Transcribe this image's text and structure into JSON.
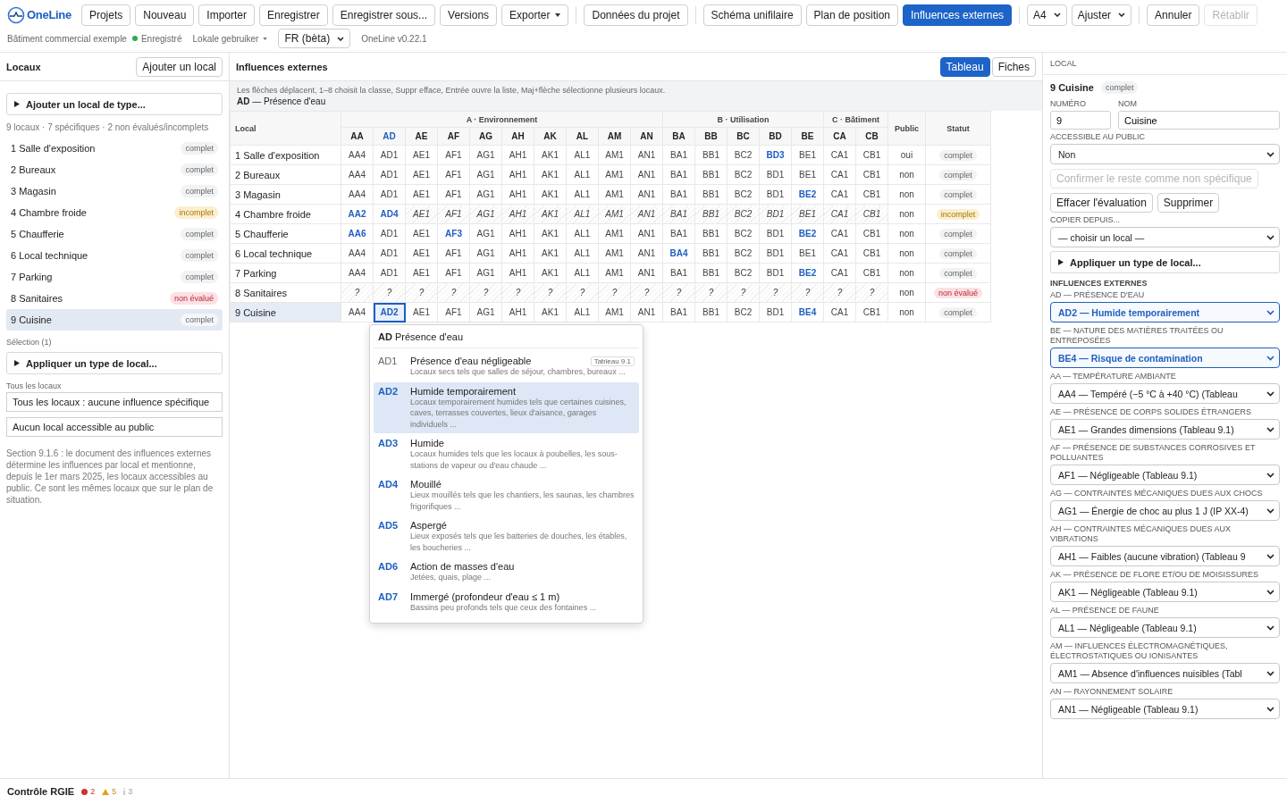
{
  "app": {
    "logo": "OneLine"
  },
  "toolbar": {
    "groups": [
      {
        "items": [
          {
            "label": "Projets",
            "kind": "button"
          },
          {
            "label": "Nouveau",
            "kind": "button"
          },
          {
            "label": "Importer",
            "kind": "button"
          },
          {
            "label": "Enregistrer",
            "kind": "button"
          },
          {
            "label": "Enregistrer sous...",
            "kind": "button"
          },
          {
            "label": "Versions",
            "kind": "button"
          },
          {
            "label": "Exporter",
            "kind": "menu"
          }
        ]
      },
      {
        "items": [
          {
            "label": "Données du projet",
            "kind": "button"
          }
        ]
      },
      {
        "items": [
          {
            "label": "Schéma unifilaire",
            "kind": "tab",
            "selected": false
          },
          {
            "label": "Plan de position",
            "kind": "tab",
            "selected": false
          },
          {
            "label": "Influences externes",
            "kind": "tab",
            "selected": true
          }
        ]
      },
      {
        "items": [
          {
            "label": "A4",
            "kind": "select"
          },
          {
            "label": "Ajuster",
            "kind": "select"
          }
        ]
      },
      {
        "items": [
          {
            "label": "Annuler",
            "kind": "button",
            "disabled": false
          },
          {
            "label": "Rétablir",
            "kind": "button",
            "disabled": true
          }
        ]
      }
    ]
  },
  "info_bar": {
    "project": "Bâtiment commercial exemple",
    "save_state": "Enregistré",
    "user": "Lokale gebruiker",
    "language": "FR (bèta)",
    "version": "OneLine v0.22.1"
  },
  "sidebar": {
    "title": "Locaux",
    "add_button": "Ajouter un local",
    "add_type": "Ajouter un local de type...",
    "summary": "9 locaux · 7 spécifiques · 2 non évalués/incomplets",
    "items": [
      {
        "label": "1 Salle d'exposition",
        "status": "complet",
        "kind": "complete",
        "selected": false
      },
      {
        "label": "2 Bureaux",
        "status": "complet",
        "kind": "complete",
        "selected": false
      },
      {
        "label": "3 Magasin",
        "status": "complet",
        "kind": "complete",
        "selected": false
      },
      {
        "label": "4 Chambre froide",
        "status": "incomplet",
        "kind": "incomplete",
        "selected": false
      },
      {
        "label": "5 Chaufferie",
        "status": "complet",
        "kind": "complete",
        "selected": false
      },
      {
        "label": "6 Local technique",
        "status": "complet",
        "kind": "complete",
        "selected": false
      },
      {
        "label": "7 Parking",
        "status": "complet",
        "kind": "complete",
        "selected": false
      },
      {
        "label": "8 Sanitaires",
        "status": "non évalué",
        "kind": "unevaluated",
        "selected": false
      },
      {
        "label": "9 Cuisine",
        "status": "complet",
        "kind": "complete",
        "selected": true
      }
    ],
    "selection_label": "Sélection (1)",
    "apply_type": "Appliquer un type de local...",
    "all_label": "Tous les locaux",
    "all_buttons": [
      "Tous les locaux : aucune influence spécifique",
      "Aucun local accessible au public"
    ],
    "note": "Section 9.1.6 : le document des influences externes détermine les influences par local et mentionne, depuis le 1er mars 2025, les locaux accessibles au public. Ce sont les mêmes locaux que sur le plan de situation."
  },
  "center": {
    "title": "Influences externes",
    "views": [
      {
        "label": "Tableau",
        "selected": true
      },
      {
        "label": "Fiches",
        "selected": false
      }
    ],
    "hint": "Les flèches déplacent, 1–8 choisit la classe, Suppr efface, Entrée ouvre la liste, Maj+flèche sélectionne plusieurs locaux.",
    "current_influence": "**AD** — Présence d'eau",
    "table": {
      "local_header": "Local",
      "public_header": "Public",
      "status_header": "Statut",
      "groups": [
        {
          "label": "A · Environnement",
          "columns": [
            {
              "label": "AA",
              "selected": false
            },
            {
              "label": "AD",
              "selected": true
            },
            {
              "label": "AE",
              "selected": false
            },
            {
              "label": "AF",
              "selected": false
            },
            {
              "label": "AG",
              "selected": false
            },
            {
              "label": "AH",
              "selected": false
            },
            {
              "label": "AK",
              "selected": false
            },
            {
              "label": "AL",
              "selected": false
            },
            {
              "label": "AM",
              "selected": false
            },
            {
              "label": "AN",
              "selected": false
            }
          ]
        },
        {
          "label": "B · Utilisation",
          "columns": [
            {
              "label": "BA",
              "selected": false
            },
            {
              "label": "BB",
              "selected": false
            },
            {
              "label": "BC",
              "selected": false
            },
            {
              "label": "BD",
              "selected": false
            },
            {
              "label": "BE",
              "selected": false
            }
          ]
        },
        {
          "label": "C · Bâtiment",
          "columns": [
            {
              "label": "CA",
              "selected": false
            },
            {
              "label": "CB",
              "selected": false
            }
          ]
        }
      ],
      "rows": [
        {
          "local": "1 Salle d'exposition",
          "selected": false,
          "public": "oui",
          "status": "complet",
          "kind": "complete",
          "cells": [
            {
              "value": "AA4",
              "kind": "default"
            },
            {
              "value": "AD1",
              "kind": "default"
            },
            {
              "value": "AE1",
              "kind": "default"
            },
            {
              "value": "AF1",
              "kind": "default"
            },
            {
              "value": "AG1",
              "kind": "default"
            },
            {
              "value": "AH1",
              "kind": "default"
            },
            {
              "value": "AK1",
              "kind": "default"
            },
            {
              "value": "AL1",
              "kind": "default"
            },
            {
              "value": "AM1",
              "kind": "default"
            },
            {
              "value": "AN1",
              "kind": "default"
            },
            {
              "value": "BA1",
              "kind": "default"
            },
            {
              "value": "BB1",
              "kind": "default"
            },
            {
              "value": "BC2",
              "kind": "default"
            },
            {
              "value": "BD3",
              "kind": "specific"
            },
            {
              "value": "BE1",
              "kind": "default"
            },
            {
              "value": "CA1",
              "kind": "default"
            },
            {
              "value": "CB1",
              "kind": "default"
            }
          ]
        },
        {
          "local": "2 Bureaux",
          "selected": false,
          "public": "non",
          "status": "complet",
          "kind": "complete",
          "cells": [
            {
              "value": "AA4",
              "kind": "default"
            },
            {
              "value": "AD1",
              "kind": "default"
            },
            {
              "value": "AE1",
              "kind": "default"
            },
            {
              "value": "AF1",
              "kind": "default"
            },
            {
              "value": "AG1",
              "kind": "default"
            },
            {
              "value": "AH1",
              "kind": "default"
            },
            {
              "value": "AK1",
              "kind": "default"
            },
            {
              "value": "AL1",
              "kind": "default"
            },
            {
              "value": "AM1",
              "kind": "default"
            },
            {
              "value": "AN1",
              "kind": "default"
            },
            {
              "value": "BA1",
              "kind": "default"
            },
            {
              "value": "BB1",
              "kind": "default"
            },
            {
              "value": "BC2",
              "kind": "default"
            },
            {
              "value": "BD1",
              "kind": "default"
            },
            {
              "value": "BE1",
              "kind": "default"
            },
            {
              "value": "CA1",
              "kind": "default"
            },
            {
              "value": "CB1",
              "kind": "default"
            }
          ]
        },
        {
          "local": "3 Magasin",
          "selected": false,
          "public": "non",
          "status": "complet",
          "kind": "complete",
          "cells": [
            {
              "value": "AA4",
              "kind": "default"
            },
            {
              "value": "AD1",
              "kind": "default"
            },
            {
              "value": "AE1",
              "kind": "default"
            },
            {
              "value": "AF1",
              "kind": "default"
            },
            {
              "value": "AG1",
              "kind": "default"
            },
            {
              "value": "AH1",
              "kind": "default"
            },
            {
              "value": "AK1",
              "kind": "default"
            },
            {
              "value": "AL1",
              "kind": "default"
            },
            {
              "value": "AM1",
              "kind": "default"
            },
            {
              "value": "AN1",
              "kind": "default"
            },
            {
              "value": "BA1",
              "kind": "default"
            },
            {
              "value": "BB1",
              "kind": "default"
            },
            {
              "value": "BC2",
              "kind": "default"
            },
            {
              "value": "BD1",
              "kind": "default"
            },
            {
              "value": "BE2",
              "kind": "specific"
            },
            {
              "value": "CA1",
              "kind": "default"
            },
            {
              "value": "CB1",
              "kind": "default"
            }
          ]
        },
        {
          "local": "4 Chambre froide",
          "selected": false,
          "public": "non",
          "status": "incomplet",
          "kind": "incomplete",
          "cells": [
            {
              "value": "AA2",
              "kind": "specific"
            },
            {
              "value": "AD4",
              "kind": "specific"
            },
            {
              "value": "AE1",
              "kind": "pending"
            },
            {
              "value": "AF1",
              "kind": "pending"
            },
            {
              "value": "AG1",
              "kind": "pending"
            },
            {
              "value": "AH1",
              "kind": "pending"
            },
            {
              "value": "AK1",
              "kind": "pending"
            },
            {
              "value": "AL1",
              "kind": "pending"
            },
            {
              "value": "AM1",
              "kind": "pending"
            },
            {
              "value": "AN1",
              "kind": "pending"
            },
            {
              "value": "BA1",
              "kind": "pending"
            },
            {
              "value": "BB1",
              "kind": "pending"
            },
            {
              "value": "BC2",
              "kind": "pending"
            },
            {
              "value": "BD1",
              "kind": "pending"
            },
            {
              "value": "BE1",
              "kind": "pending"
            },
            {
              "value": "CA1",
              "kind": "pending"
            },
            {
              "value": "CB1",
              "kind": "pending"
            }
          ]
        },
        {
          "local": "5 Chaufferie",
          "selected": false,
          "public": "non",
          "status": "complet",
          "kind": "complete",
          "cells": [
            {
              "value": "AA6",
              "kind": "specific"
            },
            {
              "value": "AD1",
              "kind": "default"
            },
            {
              "value": "AE1",
              "kind": "default"
            },
            {
              "value": "AF3",
              "kind": "specific"
            },
            {
              "value": "AG1",
              "kind": "default"
            },
            {
              "value": "AH1",
              "kind": "default"
            },
            {
              "value": "AK1",
              "kind": "default"
            },
            {
              "value": "AL1",
              "kind": "default"
            },
            {
              "value": "AM1",
              "kind": "default"
            },
            {
              "value": "AN1",
              "kind": "default"
            },
            {
              "value": "BA1",
              "kind": "default"
            },
            {
              "value": "BB1",
              "kind": "default"
            },
            {
              "value": "BC2",
              "kind": "default"
            },
            {
              "value": "BD1",
              "kind": "default"
            },
            {
              "value": "BE2",
              "kind": "specific"
            },
            {
              "value": "CA1",
              "kind": "default"
            },
            {
              "value": "CB1",
              "kind": "default"
            }
          ]
        },
        {
          "local": "6 Local technique",
          "selected": false,
          "public": "non",
          "status": "complet",
          "kind": "complete",
          "cells": [
            {
              "value": "AA4",
              "kind": "default"
            },
            {
              "value": "AD1",
              "kind": "default"
            },
            {
              "value": "AE1",
              "kind": "default"
            },
            {
              "value": "AF1",
              "kind": "default"
            },
            {
              "value": "AG1",
              "kind": "default"
            },
            {
              "value": "AH1",
              "kind": "default"
            },
            {
              "value": "AK1",
              "kind": "default"
            },
            {
              "value": "AL1",
              "kind": "default"
            },
            {
              "value": "AM1",
              "kind": "default"
            },
            {
              "value": "AN1",
              "kind": "default"
            },
            {
              "value": "BA4",
              "kind": "specific"
            },
            {
              "value": "BB1",
              "kind": "default"
            },
            {
              "value": "BC2",
              "kind": "default"
            },
            {
              "value": "BD1",
              "kind": "default"
            },
            {
              "value": "BE1",
              "kind": "default"
            },
            {
              "value": "CA1",
              "kind": "default"
            },
            {
              "value": "CB1",
              "kind": "default"
            }
          ]
        },
        {
          "local": "7 Parking",
          "selected": false,
          "public": "non",
          "status": "complet",
          "kind": "complete",
          "cells": [
            {
              "value": "AA4",
              "kind": "default"
            },
            {
              "value": "AD1",
              "kind": "default"
            },
            {
              "value": "AE1",
              "kind": "default"
            },
            {
              "value": "AF1",
              "kind": "default"
            },
            {
              "value": "AG1",
              "kind": "default"
            },
            {
              "value": "AH1",
              "kind": "default"
            },
            {
              "value": "AK1",
              "kind": "default"
            },
            {
              "value": "AL1",
              "kind": "default"
            },
            {
              "value": "AM1",
              "kind": "default"
            },
            {
              "value": "AN1",
              "kind": "default"
            },
            {
              "value": "BA1",
              "kind": "default"
            },
            {
              "value": "BB1",
              "kind": "default"
            },
            {
              "value": "BC2",
              "kind": "default"
            },
            {
              "value": "BD1",
              "kind": "default"
            },
            {
              "value": "BE2",
              "kind": "specific"
            },
            {
              "value": "CA1",
              "kind": "default"
            },
            {
              "value": "CB1",
              "kind": "default"
            }
          ]
        },
        {
          "local": "8 Sanitaires",
          "selected": false,
          "public": "non",
          "status": "non évalué",
          "kind": "unevaluated",
          "cells": [
            {
              "value": "?",
              "kind": "pending"
            },
            {
              "value": "?",
              "kind": "pending"
            },
            {
              "value": "?",
              "kind": "pending"
            },
            {
              "value": "?",
              "kind": "pending"
            },
            {
              "value": "?",
              "kind": "pending"
            },
            {
              "value": "?",
              "kind": "pending"
            },
            {
              "value": "?",
              "kind": "pending"
            },
            {
              "value": "?",
              "kind": "pending"
            },
            {
              "value": "?",
              "kind": "pending"
            },
            {
              "value": "?",
              "kind": "pending"
            },
            {
              "value": "?",
              "kind": "pending"
            },
            {
              "value": "?",
              "kind": "pending"
            },
            {
              "value": "?",
              "kind": "pending"
            },
            {
              "value": "?",
              "kind": "pending"
            },
            {
              "value": "?",
              "kind": "pending"
            },
            {
              "value": "?",
              "kind": "pending"
            },
            {
              "value": "?",
              "kind": "pending"
            }
          ]
        },
        {
          "local": "9 Cuisine",
          "selected": true,
          "public": "non",
          "status": "complet",
          "kind": "complete",
          "cells": [
            {
              "value": "AA4",
              "kind": "default"
            },
            {
              "value": "AD2",
              "kind": "specific"
            },
            {
              "value": "AE1",
              "kind": "default"
            },
            {
              "value": "AF1",
              "kind": "default"
            },
            {
              "value": "AG1",
              "kind": "default"
            },
            {
              "value": "AH1",
              "kind": "default"
            },
            {
              "value": "AK1",
              "kind": "default"
            },
            {
              "value": "AL1",
              "kind": "default"
            },
            {
              "value": "AM1",
              "kind": "default"
            },
            {
              "value": "AN1",
              "kind": "default"
            },
            {
              "value": "BA1",
              "kind": "default"
            },
            {
              "value": "BB1",
              "kind": "default"
            },
            {
              "value": "BC2",
              "kind": "default"
            },
            {
              "value": "BD1",
              "kind": "default"
            },
            {
              "value": "BE4",
              "kind": "specific"
            },
            {
              "value": "CA1",
              "kind": "default"
            },
            {
              "value": "CB1",
              "kind": "default"
            }
          ]
        }
      ]
    },
    "popup": {
      "title": "**AD** Présence d'eau",
      "options": [
        {
          "code": "AD1",
          "kind": "default",
          "title": "Présence d'eau négligeable",
          "tag": "Tableau 9.1",
          "description": "Locaux secs tels que salles de séjour, chambres, bureaux ...",
          "selected": false
        },
        {
          "code": "AD2",
          "kind": "specific",
          "title": "Humide temporairement",
          "description": "Locaux temporairement humides tels que certaines cuisines, caves, terrasses couvertes, lieux d'aisance, garages individuels ...",
          "selected": true
        },
        {
          "code": "AD3",
          "kind": "specific",
          "title": "Humide",
          "description": "Locaux humides tels que les locaux à poubelles, les sous-stations de vapeur ou d'eau chaude ...",
          "selected": false
        },
        {
          "code": "AD4",
          "kind": "specific",
          "title": "Mouillé",
          "description": "Lieux mouillés tels que les chantiers, les saunas, les chambres frigorifiques ...",
          "selected": false
        },
        {
          "code": "AD5",
          "kind": "specific",
          "title": "Aspergé",
          "description": "Lieux exposés tels que les batteries de douches, les étables, les boucheries ...",
          "selected": false
        },
        {
          "code": "AD6",
          "kind": "specific",
          "title": "Action de masses d'eau",
          "description": "Jetées, quais, plage ...",
          "selected": false
        },
        {
          "code": "AD7",
          "kind": "specific",
          "title": "Immergé (profondeur d'eau ≤ 1 m)",
          "description": "Bassins peu profonds tels que ceux des fontaines ...",
          "selected": false
        }
      ]
    }
  },
  "detail": {
    "header": "LOCAL",
    "title": "9 Cuisine",
    "status": {
      "label": "complet",
      "kind": "complete"
    },
    "number_label": "NUMÉRO",
    "number": "9",
    "name_label": "NOM",
    "name": "Cuisine",
    "public_label": "ACCESSIBLE AU PUBLIC",
    "public": "Non",
    "confirm_button": "Confirmer le reste comme non spécifique",
    "confirm_disabled": true,
    "clear_button": "Effacer l'évaluation",
    "delete_button": "Supprimer",
    "copy_label": "COPIER DEPUIS...",
    "copy_value": "— choisir un local —",
    "apply_type": "Appliquer un type de local...",
    "influences_title": "INFLUENCES EXTERNES",
    "influences": [
      {
        "label": "AD — PRÉSENCE D'EAU",
        "value": "AD2 — Humide temporairement",
        "specific": true
      },
      {
        "label": "BE — NATURE DES MATIÈRES TRAITÉES OU ENTREPOSÉES",
        "value": "BE4 — Risque de contamination",
        "specific": true
      },
      {
        "label": "AA — TEMPÉRATURE AMBIANTE",
        "value": "AA4 — Tempéré (−5 °C à +40 °C) (Tableau",
        "specific": false
      },
      {
        "label": "AE — PRÉSENCE DE CORPS SOLIDES ÉTRANGERS",
        "value": "AE1 — Grandes dimensions (Tableau 9.1)",
        "specific": false
      },
      {
        "label": "AF — PRÉSENCE DE SUBSTANCES CORROSIVES ET POLLUANTES",
        "value": "AF1 — Négligeable (Tableau 9.1)",
        "specific": false
      },
      {
        "label": "AG — CONTRAINTES MÉCANIQUES DUES AUX CHOCS",
        "value": "AG1 — Énergie de choc au plus 1 J (IP XX-4)",
        "specific": false
      },
      {
        "label": "AH — CONTRAINTES MÉCANIQUES DUES AUX VIBRATIONS",
        "value": "AH1 — Faibles (aucune vibration) (Tableau 9",
        "specific": false
      },
      {
        "label": "AK — PRÉSENCE DE FLORE ET/OU DE MOISISSURES",
        "value": "AK1 — Négligeable (Tableau 9.1)",
        "specific": false
      },
      {
        "label": "AL — PRÉSENCE DE FAUNE",
        "value": "AL1 — Négligeable (Tableau 9.1)",
        "specific": false
      },
      {
        "label": "AM — INFLUENCES ÉLECTROMAGNÉTIQUES, ÉLECTROSTATIQUES OU IONISANTES",
        "value": "AM1 — Absence d'influences nuisibles (Tabl",
        "specific": false
      },
      {
        "label": "AN — RAYONNEMENT SOLAIRE",
        "value": "AN1 — Négligeable (Tableau 9.1)",
        "specific": false
      }
    ]
  },
  "status_bar": {
    "title": "Contrôle RGIE",
    "counts": [
      {
        "kind": "error",
        "count": "2"
      },
      {
        "kind": "warning",
        "count": "5"
      },
      {
        "kind": "info",
        "count": "3"
      }
    ]
  }
}
